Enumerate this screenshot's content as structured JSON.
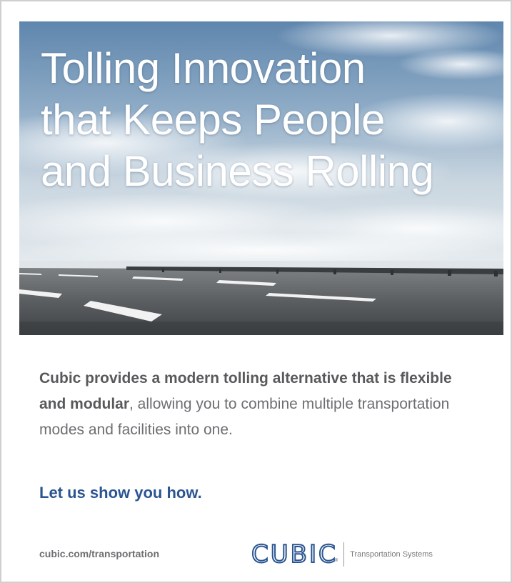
{
  "hero": {
    "image": "open-highway-under-cloudy-sky",
    "headline_lines": [
      "Tolling Innovation",
      "that Keeps People",
      "and Business Rolling"
    ]
  },
  "body": {
    "bold_text": "Cubic provides a modern tolling alternative that is flexible and modular",
    "regular_text": ", allowing you to combine multiple transportation modes and facilities into one."
  },
  "cta": "Let us show you how.",
  "footer": {
    "url": "cubic.com/transportation",
    "logo_word": "CUBIC",
    "logo_trademark": "®",
    "logo_tagline": "Transportation Systems"
  },
  "colors": {
    "brand_blue": "#2a5592",
    "body_gray": "#6d6e71",
    "sky_top": "#5f86ad",
    "road": "#595d60"
  }
}
